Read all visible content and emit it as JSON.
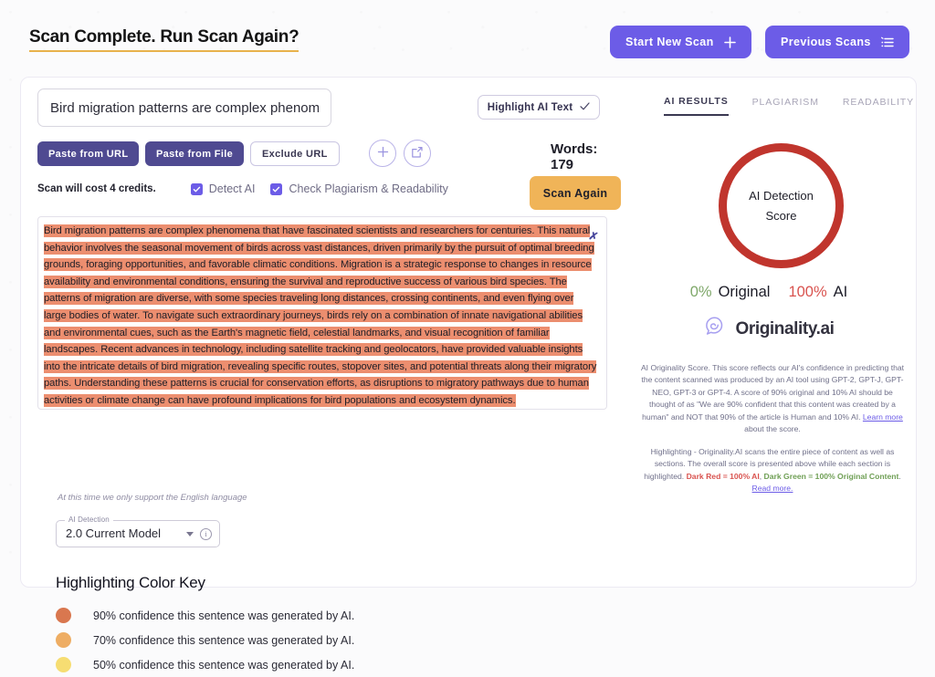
{
  "header": {
    "title": "Scan Complete. Run Scan Again?",
    "start_new_scan": "Start New Scan",
    "previous_scans": "Previous Scans"
  },
  "editor": {
    "title_value": "Bird migration patterns are complex phenom",
    "title_placeholder": "Title",
    "paste_from_url": "Paste from URL",
    "paste_from_file": "Paste from File",
    "exclude_url": "Exclude URL",
    "scan_cost": "Scan will cost 4 credits.",
    "detect_ai": "Detect AI",
    "check_plagiarism": "Check Plagiarism & Readability",
    "highlight_ai_text": "Highlight AI Text",
    "words": "Words: 179",
    "scan_again": "Scan Again",
    "language_note": "At this time we only support the English language",
    "scanned_text": "Bird migration patterns are complex phenomena that have fascinated scientists and researchers for centuries. This natural behavior involves the seasonal movement of birds across vast distances, driven primarily by the pursuit of optimal breeding grounds, foraging opportunities, and favorable climatic conditions. Migration is a strategic response to changes in resource availability and environmental conditions, ensuring the survival and reproductive success of various bird species. The patterns of migration are diverse, with some species traveling long distances, crossing continents, and even flying over large bodies of water. To navigate such extraordinary journeys, birds rely on a combination of innate navigational abilities and environmental cues, such as the Earth's magnetic field, celestial landmarks, and visual recognition of familiar landscapes. Recent advances in technology, including satellite tracking and geolocators, have provided valuable insights into the intricate details of bird migration, revealing specific routes, stopover sites, and potential threats along their migratory paths. Understanding these patterns is crucial for conservation efforts, as disruptions to migratory pathways due to human activities or climate change can have profound implications for bird populations and ecosystem dynamics.",
    "highlight_color": "#ec8e6f"
  },
  "model_select": {
    "legend": "AI Detection",
    "value": "2.0 Current Model"
  },
  "color_key": {
    "title": "Highlighting Color Key",
    "items": [
      {
        "color": "#d9774f",
        "text": "90% confidence this sentence was generated by AI."
      },
      {
        "color": "#eead63",
        "text": "70% confidence this sentence was generated by AI."
      },
      {
        "color": "#f6dd72",
        "text": "50% confidence this sentence was generated by AI."
      }
    ]
  },
  "results": {
    "tabs": [
      {
        "label": "AI RESULTS",
        "active": true
      },
      {
        "label": "PLAGIARISM",
        "active": false
      },
      {
        "label": "READABILITY",
        "active": false
      }
    ],
    "score_line_1": "AI Detection",
    "score_line_2": "Score",
    "score_ring_color": "#c0352d",
    "original_pct": "0%",
    "original_label": "Original",
    "ai_pct": "100%",
    "ai_label": "AI",
    "brand_name": "Originality.ai",
    "info_1_a": "AI Originality Score. This score reflects our AI's confidence in predicting that the content scanned was produced by an AI tool using GPT-2, GPT-J, GPT-NEO, GPT-3 or GPT-4. A score of 90% original and 10% AI should be thought of as \"We are 90% confident that this content was created by a human\" and NOT that 90% of the article is Human and 10% AI. ",
    "info_1_link": "Learn more",
    "info_1_b": " about the score.",
    "info_2_a": "Highlighting - Originality.AI scans the entire piece of content as well as sections. The overall score is presented above while each section is highlighted. ",
    "info_2_red": "Dark Red = 100% AI",
    "info_2_mid": ", ",
    "info_2_green": "Dark Green = 100% Original Content",
    "info_2_b": ". ",
    "info_2_link": "Read more."
  }
}
